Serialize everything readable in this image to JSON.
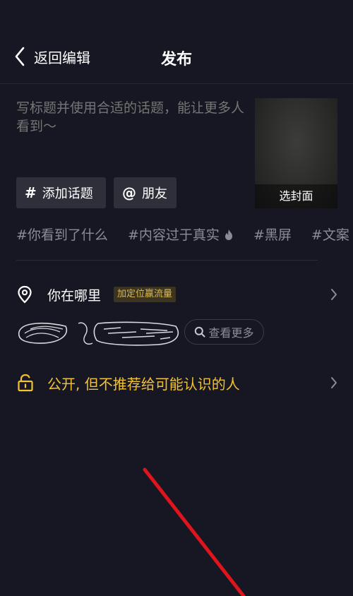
{
  "header": {
    "back_label": "返回编辑",
    "title": "发布"
  },
  "caption": {
    "placeholder": "写标题并使用合适的话题，能让更多人看到～",
    "value": ""
  },
  "cover": {
    "label": "选封面"
  },
  "chips": {
    "topic": {
      "symbol": "#",
      "label": "添加话题"
    },
    "friend": {
      "symbol": "@",
      "label": "朋友"
    }
  },
  "tags": [
    "#你看到了什么",
    "#内容过于真实",
    "#黑屏",
    "#文案"
  ],
  "location": {
    "label": "你在哪里",
    "badge": "加定位赢流量",
    "see_more": "查看更多"
  },
  "privacy": {
    "label": "公开, 但不推荐给可能认识的人"
  },
  "colors": {
    "background": "#161722",
    "accent_yellow": "#f2c230",
    "annotation_red": "#e0141c"
  }
}
